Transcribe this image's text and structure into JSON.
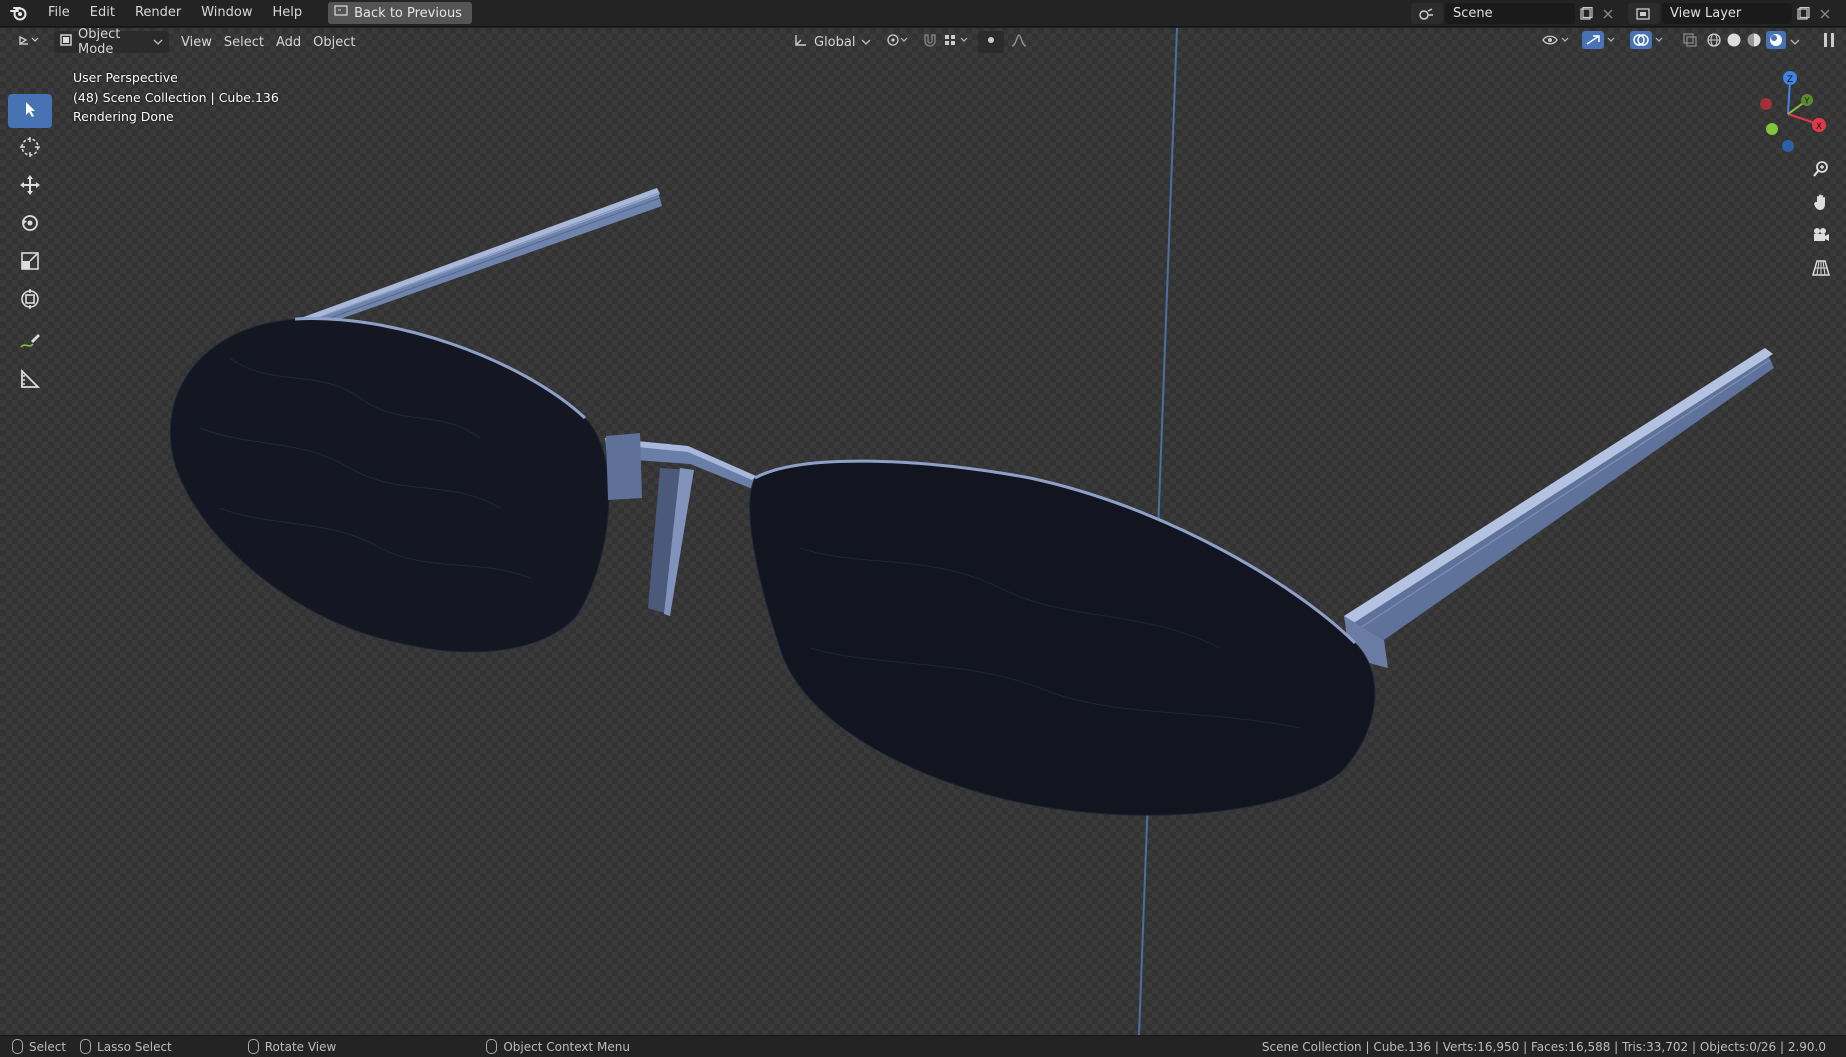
{
  "app": {
    "menus": [
      "File",
      "Edit",
      "Render",
      "Window",
      "Help"
    ],
    "back_button": "Back to Previous",
    "scene_name": "Scene",
    "view_layer_name": "View Layer"
  },
  "viewport_header": {
    "mode": "Object Mode",
    "menus": [
      "View",
      "Select",
      "Add",
      "Object"
    ],
    "transform_orientation": "Global"
  },
  "viewport_overlay": {
    "perspective": "User Perspective",
    "collection_info": "(48) Scene Collection | Cube.136",
    "render_status": "Rendering Done"
  },
  "gizmo": {
    "z_label": "Z",
    "y_label": "Y",
    "x_label": "X"
  },
  "statusbar": {
    "select": "Select",
    "lasso": "Lasso Select",
    "rotate": "Rotate View",
    "context_menu": "Object Context Menu",
    "stats": "Scene Collection | Cube.136 | Verts:16,950 | Faces:16,588 | Tris:33,702 | Objects:0/26 | 2.90.0"
  },
  "colors": {
    "accent": "#4772b3",
    "lens": "#13151d",
    "frame": "#7d8fb5",
    "axis_x": "#e0394b",
    "axis_y": "#7ec63a",
    "axis_z": "#3e85e6"
  }
}
